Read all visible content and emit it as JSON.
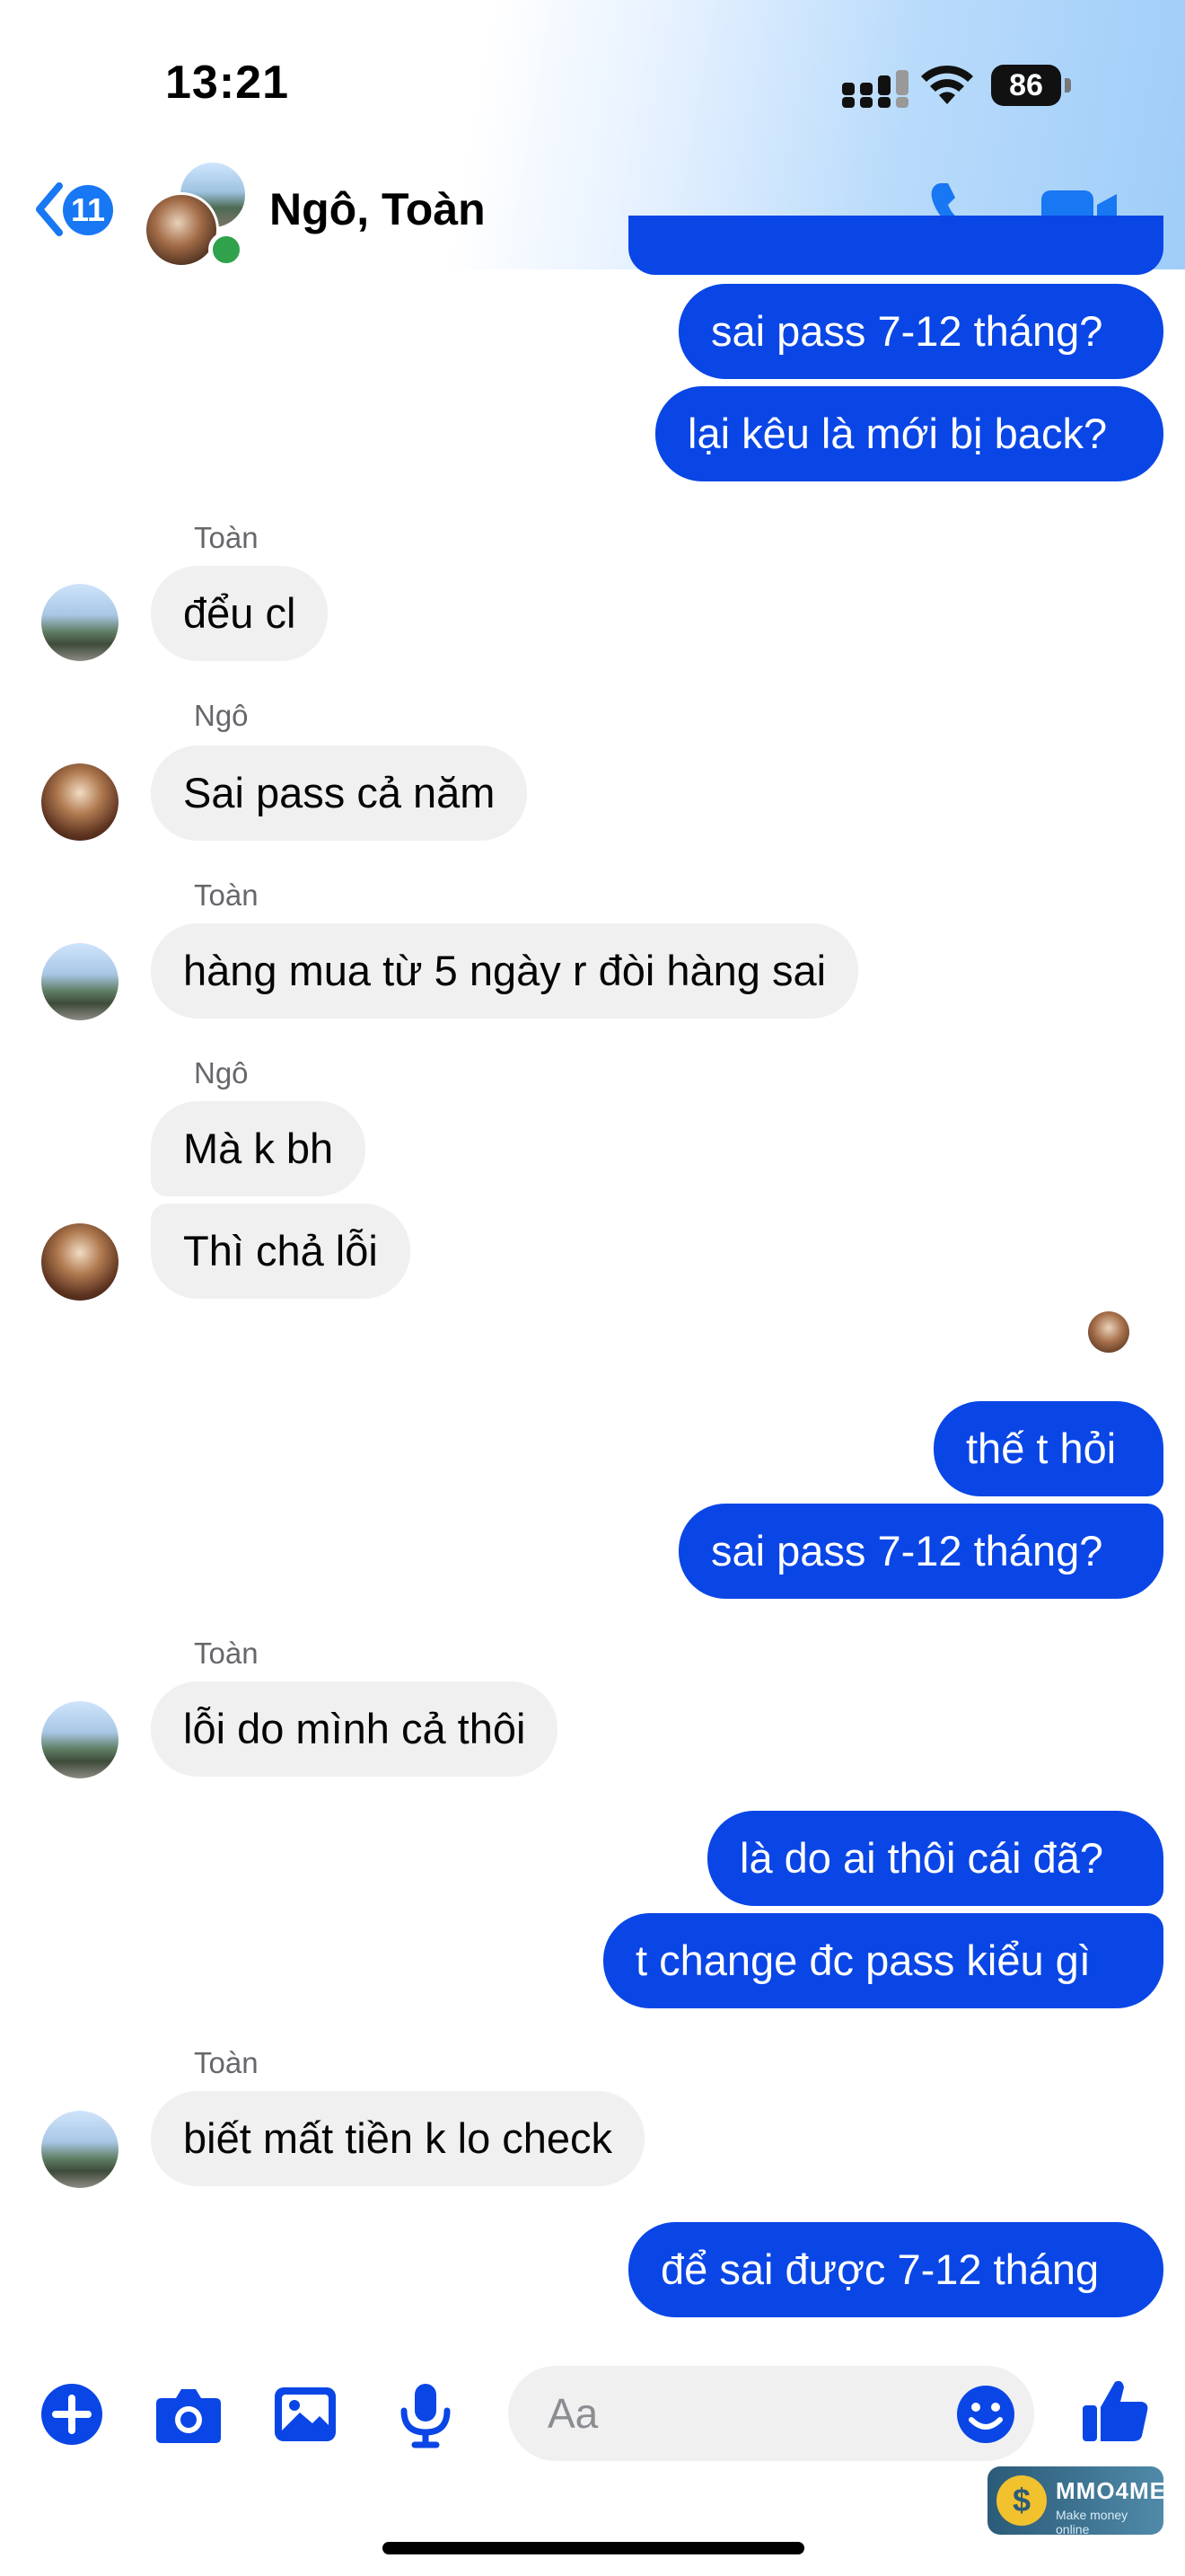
{
  "status_bar": {
    "time": "13:21",
    "battery": "86"
  },
  "header": {
    "back_count": "11",
    "title": "Ngô, Toàn"
  },
  "messages": [
    {
      "text": "sai pass 7-12 tháng?"
    },
    {
      "text": "lại kêu là mới bị back?"
    },
    {
      "sender": "Toàn",
      "text": "đểu cl"
    },
    {
      "sender": "Ngô",
      "text": "Sai pass cả năm"
    },
    {
      "sender": "Toàn",
      "text": "hàng mua từ 5 ngày r đòi hàng sai"
    },
    {
      "sender": "Ngô",
      "text": "Mà k bh"
    },
    {
      "text": "Thì chả lỗi"
    },
    {
      "text": "thế t hỏi"
    },
    {
      "text": "sai pass 7-12 tháng?"
    },
    {
      "sender": "Toàn",
      "text": "lỗi do mình cả thôi"
    },
    {
      "text": "là do ai thôi cái đã?"
    },
    {
      "text": "t change đc pass kiểu gì"
    },
    {
      "sender": "Toàn",
      "text": "biết mất tiền k lo check"
    },
    {
      "text": "để sai được 7-12 tháng"
    }
  ],
  "composer": {
    "placeholder": "Aa",
    "icons": [
      "plus-icon",
      "camera-icon",
      "image-icon",
      "microphone-icon",
      "emoji-icon",
      "thumbs-up-icon"
    ]
  },
  "watermark": {
    "title": "MMO4ME",
    "subtitle": "Make money online"
  },
  "colors": {
    "outgoing_bubble": "#0a46e6",
    "incoming_bubble": "#f0f0f0",
    "accent": "#1877f2",
    "online": "#31a24c"
  }
}
